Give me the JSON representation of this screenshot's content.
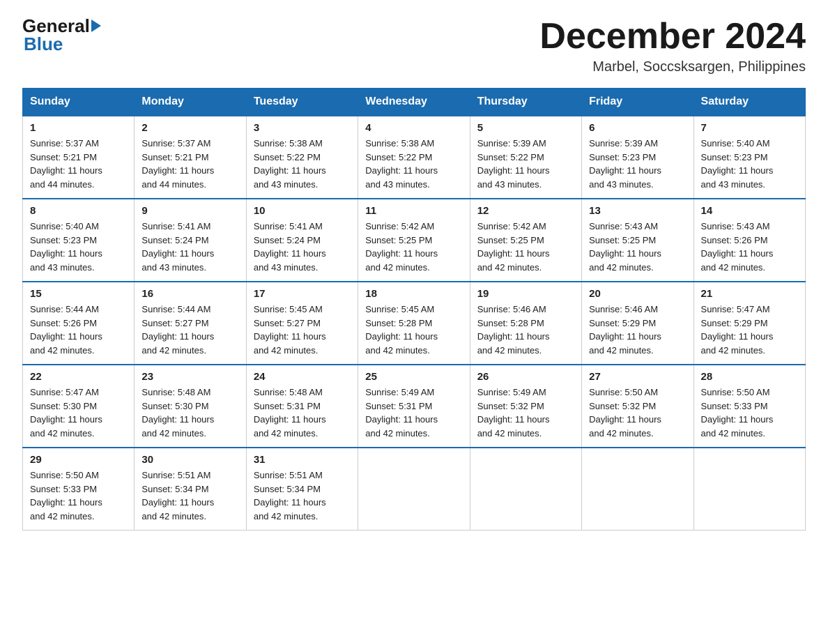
{
  "header": {
    "logo_general": "General",
    "logo_blue": "Blue",
    "month_title": "December 2024",
    "subtitle": "Marbel, Soccsksargen, Philippines"
  },
  "days_of_week": [
    "Sunday",
    "Monday",
    "Tuesday",
    "Wednesday",
    "Thursday",
    "Friday",
    "Saturday"
  ],
  "weeks": [
    [
      {
        "day": "1",
        "sunrise": "5:37 AM",
        "sunset": "5:21 PM",
        "daylight": "11 hours and 44 minutes."
      },
      {
        "day": "2",
        "sunrise": "5:37 AM",
        "sunset": "5:21 PM",
        "daylight": "11 hours and 44 minutes."
      },
      {
        "day": "3",
        "sunrise": "5:38 AM",
        "sunset": "5:22 PM",
        "daylight": "11 hours and 43 minutes."
      },
      {
        "day": "4",
        "sunrise": "5:38 AM",
        "sunset": "5:22 PM",
        "daylight": "11 hours and 43 minutes."
      },
      {
        "day": "5",
        "sunrise": "5:39 AM",
        "sunset": "5:22 PM",
        "daylight": "11 hours and 43 minutes."
      },
      {
        "day": "6",
        "sunrise": "5:39 AM",
        "sunset": "5:23 PM",
        "daylight": "11 hours and 43 minutes."
      },
      {
        "day": "7",
        "sunrise": "5:40 AM",
        "sunset": "5:23 PM",
        "daylight": "11 hours and 43 minutes."
      }
    ],
    [
      {
        "day": "8",
        "sunrise": "5:40 AM",
        "sunset": "5:23 PM",
        "daylight": "11 hours and 43 minutes."
      },
      {
        "day": "9",
        "sunrise": "5:41 AM",
        "sunset": "5:24 PM",
        "daylight": "11 hours and 43 minutes."
      },
      {
        "day": "10",
        "sunrise": "5:41 AM",
        "sunset": "5:24 PM",
        "daylight": "11 hours and 43 minutes."
      },
      {
        "day": "11",
        "sunrise": "5:42 AM",
        "sunset": "5:25 PM",
        "daylight": "11 hours and 42 minutes."
      },
      {
        "day": "12",
        "sunrise": "5:42 AM",
        "sunset": "5:25 PM",
        "daylight": "11 hours and 42 minutes."
      },
      {
        "day": "13",
        "sunrise": "5:43 AM",
        "sunset": "5:25 PM",
        "daylight": "11 hours and 42 minutes."
      },
      {
        "day": "14",
        "sunrise": "5:43 AM",
        "sunset": "5:26 PM",
        "daylight": "11 hours and 42 minutes."
      }
    ],
    [
      {
        "day": "15",
        "sunrise": "5:44 AM",
        "sunset": "5:26 PM",
        "daylight": "11 hours and 42 minutes."
      },
      {
        "day": "16",
        "sunrise": "5:44 AM",
        "sunset": "5:27 PM",
        "daylight": "11 hours and 42 minutes."
      },
      {
        "day": "17",
        "sunrise": "5:45 AM",
        "sunset": "5:27 PM",
        "daylight": "11 hours and 42 minutes."
      },
      {
        "day": "18",
        "sunrise": "5:45 AM",
        "sunset": "5:28 PM",
        "daylight": "11 hours and 42 minutes."
      },
      {
        "day": "19",
        "sunrise": "5:46 AM",
        "sunset": "5:28 PM",
        "daylight": "11 hours and 42 minutes."
      },
      {
        "day": "20",
        "sunrise": "5:46 AM",
        "sunset": "5:29 PM",
        "daylight": "11 hours and 42 minutes."
      },
      {
        "day": "21",
        "sunrise": "5:47 AM",
        "sunset": "5:29 PM",
        "daylight": "11 hours and 42 minutes."
      }
    ],
    [
      {
        "day": "22",
        "sunrise": "5:47 AM",
        "sunset": "5:30 PM",
        "daylight": "11 hours and 42 minutes."
      },
      {
        "day": "23",
        "sunrise": "5:48 AM",
        "sunset": "5:30 PM",
        "daylight": "11 hours and 42 minutes."
      },
      {
        "day": "24",
        "sunrise": "5:48 AM",
        "sunset": "5:31 PM",
        "daylight": "11 hours and 42 minutes."
      },
      {
        "day": "25",
        "sunrise": "5:49 AM",
        "sunset": "5:31 PM",
        "daylight": "11 hours and 42 minutes."
      },
      {
        "day": "26",
        "sunrise": "5:49 AM",
        "sunset": "5:32 PM",
        "daylight": "11 hours and 42 minutes."
      },
      {
        "day": "27",
        "sunrise": "5:50 AM",
        "sunset": "5:32 PM",
        "daylight": "11 hours and 42 minutes."
      },
      {
        "day": "28",
        "sunrise": "5:50 AM",
        "sunset": "5:33 PM",
        "daylight": "11 hours and 42 minutes."
      }
    ],
    [
      {
        "day": "29",
        "sunrise": "5:50 AM",
        "sunset": "5:33 PM",
        "daylight": "11 hours and 42 minutes."
      },
      {
        "day": "30",
        "sunrise": "5:51 AM",
        "sunset": "5:34 PM",
        "daylight": "11 hours and 42 minutes."
      },
      {
        "day": "31",
        "sunrise": "5:51 AM",
        "sunset": "5:34 PM",
        "daylight": "11 hours and 42 minutes."
      },
      null,
      null,
      null,
      null
    ]
  ],
  "labels": {
    "sunrise": "Sunrise:",
    "sunset": "Sunset:",
    "daylight": "Daylight:"
  }
}
